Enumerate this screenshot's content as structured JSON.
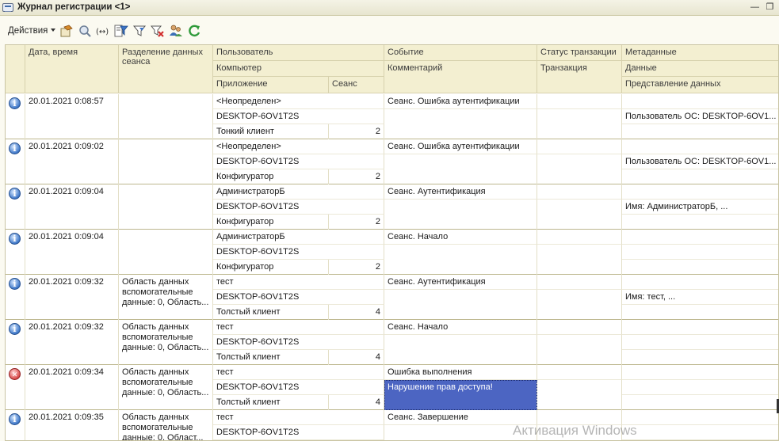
{
  "window": {
    "title": "Журнал регистрации <1>"
  },
  "toolbar": {
    "actions_label": "Действия"
  },
  "columns": {
    "date": "Дата, время",
    "separation": "Разделение данных сеанса",
    "user": "Пользователь",
    "computer": "Компьютер",
    "application": "Приложение",
    "session": "Сеанс",
    "event": "Событие",
    "comment": "Комментарий",
    "transaction_status": "Статус транзакции",
    "transaction": "Транзакция",
    "metadata": "Метаданные",
    "data": "Данные",
    "data_presentation": "Представление данных"
  },
  "rows": [
    {
      "level": "info",
      "date": "20.01.2021 0:08:57",
      "separation": "",
      "user": "<Неопределен>",
      "computer": "DESKTOP-6OV1T2S",
      "application": "Тонкий клиент",
      "session": "2",
      "event": "Сеанс. Ошибка аутентификации",
      "comment": "",
      "data": "Пользователь ОС: DESKTOP-6OV1..."
    },
    {
      "level": "info",
      "date": "20.01.2021 0:09:02",
      "separation": "",
      "user": "<Неопределен>",
      "computer": "DESKTOP-6OV1T2S",
      "application": "Конфигуратор",
      "session": "2",
      "event": "Сеанс. Ошибка аутентификации",
      "comment": "",
      "data": "Пользователь ОС: DESKTOP-6OV1..."
    },
    {
      "level": "info",
      "date": "20.01.2021 0:09:04",
      "separation": "",
      "user": "АдминистраторБ",
      "computer": "DESKTOP-6OV1T2S",
      "application": "Конфигуратор",
      "session": "2",
      "event": "Сеанс. Аутентификация",
      "comment": "",
      "data": "Имя: АдминистраторБ, ..."
    },
    {
      "level": "info",
      "date": "20.01.2021 0:09:04",
      "separation": "",
      "user": "АдминистраторБ",
      "computer": "DESKTOP-6OV1T2S",
      "application": "Конфигуратор",
      "session": "2",
      "event": "Сеанс. Начало",
      "comment": "",
      "data": ""
    },
    {
      "level": "info",
      "date": "20.01.2021 0:09:32",
      "separation": "Область данных вспомогательные данные: 0, Область...",
      "user": "тест",
      "computer": "DESKTOP-6OV1T2S",
      "application": "Толстый клиент",
      "session": "4",
      "event": "Сеанс. Аутентификация",
      "comment": "",
      "data": "Имя: тест, ..."
    },
    {
      "level": "info",
      "date": "20.01.2021 0:09:32",
      "separation": "Область данных вспомогательные данные: 0, Область...",
      "user": "тест",
      "computer": "DESKTOP-6OV1T2S",
      "application": "Толстый клиент",
      "session": "4",
      "event": "Сеанс. Начало",
      "comment": "",
      "data": ""
    },
    {
      "level": "error",
      "date": "20.01.2021 0:09:34",
      "separation": "Область данных вспомогательные данные: 0, Область...",
      "user": "тест",
      "computer": "DESKTOP-6OV1T2S",
      "application": "Толстый клиент",
      "session": "4",
      "event": "Ошибка выполнения",
      "comment": "Нарушение прав доступа!",
      "data": ""
    },
    {
      "level": "info",
      "date": "20.01.2021 0:09:35",
      "separation": "Область данных вспомогательные данные: 0, Област...",
      "user": "тест",
      "computer": "DESKTOP-6OV1T2S",
      "application": "",
      "session": "",
      "event": "Сеанс. Завершение",
      "comment": "",
      "data": ""
    }
  ],
  "watermark": "Активация Windows"
}
